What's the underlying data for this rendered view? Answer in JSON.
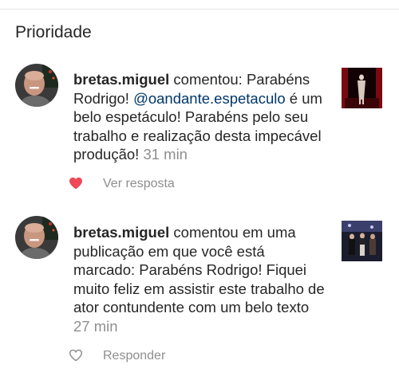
{
  "section": {
    "title": "Prioridade"
  },
  "notifications": [
    {
      "username": "bretas.miguel",
      "text_before_mention": " comentou: Parabéns Rodrigo! ",
      "mention": "@oandante.espetaculo",
      "text_after_mention": " é um belo espetáculo! Parabéns pelo seu trabalho e realização desta impecável produção!",
      "time": "31 min",
      "liked": true,
      "action_label": "Ver resposta",
      "heart_icon": "heart-filled-icon",
      "heart_color": "#ed4956"
    },
    {
      "username": "bretas.miguel",
      "text": " comentou em uma publicação em que você está marcado: Parabéns Rodrigo! Fiquei muito feliz em assistir este trabalho de ator contundente com um belo texto",
      "time": "27 min",
      "liked": false,
      "action_label": "Responder",
      "heart_icon": "heart-outline-icon",
      "heart_color": "#8e8e8e"
    }
  ],
  "colors": {
    "text": "#262626",
    "secondary": "#8e8e8e",
    "mention": "#00376b",
    "like": "#ed4956",
    "divider": "#e6e6e6"
  }
}
